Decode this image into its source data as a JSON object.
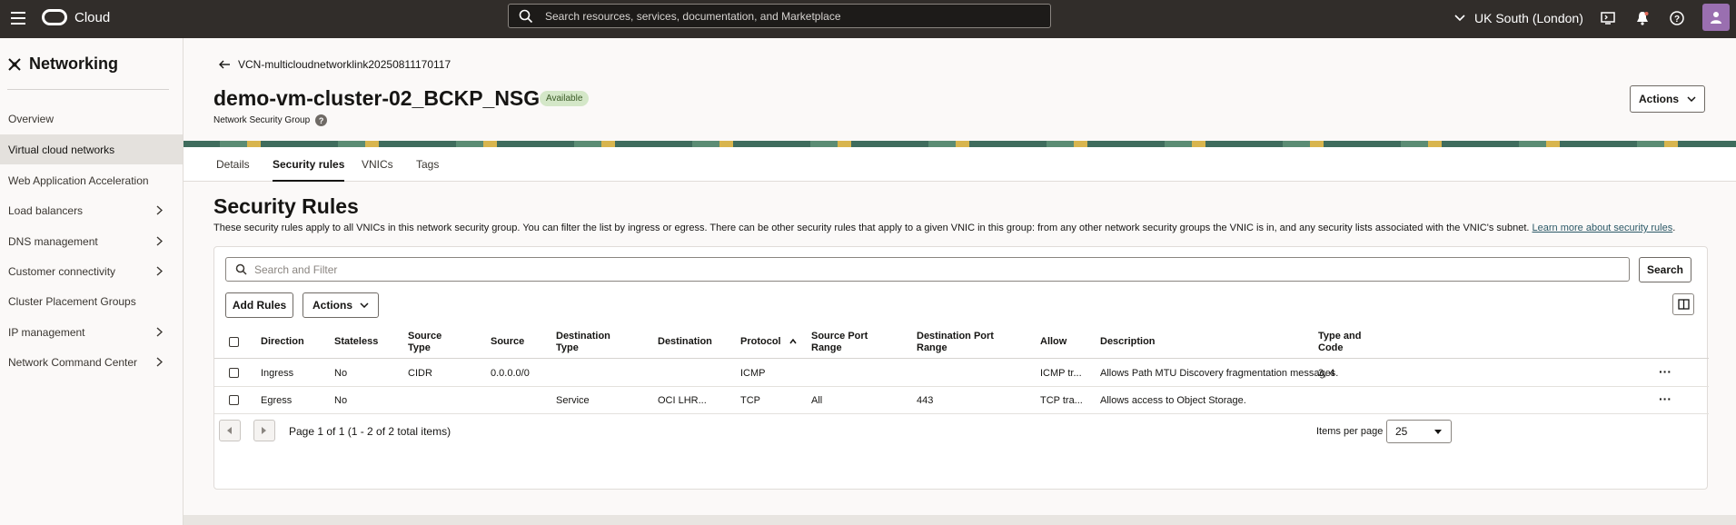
{
  "topbar": {
    "brand": "Cloud",
    "search_placeholder": "Search resources, services, documentation, and Marketplace",
    "region": "UK South (London)"
  },
  "sidebar": {
    "title": "Networking",
    "items": [
      {
        "label": "Overview",
        "chevron": false,
        "active": false
      },
      {
        "label": "Virtual cloud networks",
        "chevron": false,
        "active": true
      },
      {
        "label": "Web Application Acceleration",
        "chevron": false,
        "active": false
      },
      {
        "label": "Load balancers",
        "chevron": true,
        "active": false
      },
      {
        "label": "DNS management",
        "chevron": true,
        "active": false
      },
      {
        "label": "Customer connectivity",
        "chevron": true,
        "active": false
      },
      {
        "label": "Cluster Placement Groups",
        "chevron": false,
        "active": false
      },
      {
        "label": "IP management",
        "chevron": true,
        "active": false
      },
      {
        "label": "Network Command Center",
        "chevron": true,
        "active": false
      }
    ]
  },
  "header": {
    "back_link": "VCN-multicloudnetworklink20250811170117",
    "title": "demo-vm-cluster-02_BCKP_NSG",
    "status": "Available",
    "subtitle": "Network Security Group",
    "actions_label": "Actions"
  },
  "tabs": [
    "Details",
    "Security rules",
    "VNICs",
    "Tags"
  ],
  "section": {
    "title": "Security Rules",
    "description": "These security rules apply to all VNICs in this network security group. You can filter the list by ingress or egress. There can be other security rules that apply to a given VNIC in this group: from any other network security groups the VNIC is in, and any security lists associated with the VNIC's subnet.",
    "learn_more": "Learn more about security rules",
    "filter_placeholder": "Search and Filter",
    "search_button": "Search",
    "add_rules_button": "Add Rules",
    "actions_button": "Actions"
  },
  "table": {
    "columns": [
      [
        "Direction"
      ],
      [
        "Stateless"
      ],
      [
        "Source",
        "Type"
      ],
      [
        "Source"
      ],
      [
        "Destination",
        "Type"
      ],
      [
        "Destination"
      ],
      [
        "Protocol"
      ],
      [
        "Source Port",
        "Range"
      ],
      [
        "Destination Port",
        "Range"
      ],
      [
        "Allow"
      ],
      [
        "Description"
      ],
      [
        "Type and",
        "Code"
      ]
    ],
    "rows": [
      [
        "Ingress",
        "No",
        "CIDR",
        "0.0.0.0/0",
        "",
        "",
        "ICMP",
        "",
        "",
        "ICMP tr...",
        "Allows Path MTU Discovery fragmentation messages.",
        "3, 4"
      ],
      [
        "Egress",
        "No",
        "",
        "",
        "Service",
        "OCI LHR...",
        "TCP",
        "All",
        "443",
        "TCP tra...",
        "Allows access to Object Storage.",
        ""
      ]
    ]
  },
  "pagination": {
    "summary": "Page 1 of 1 (1 - 2 of 2 total items)",
    "items_per_page_label": "Items per page",
    "items_per_page_value": "25"
  }
}
